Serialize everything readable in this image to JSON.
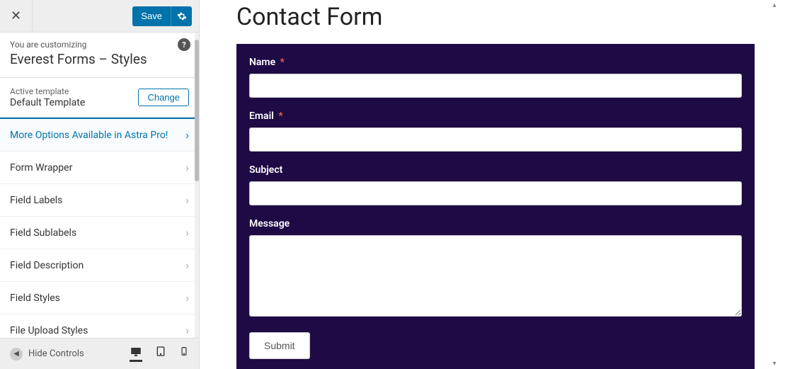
{
  "sidebar": {
    "save_label": "Save",
    "customizing_label": "You are customizing",
    "panel_title": "Everest Forms – Styles",
    "template_label": "Active template",
    "template_value": "Default Template",
    "change_label": "Change",
    "items": [
      {
        "label": "More Options Available in Astra Pro!",
        "promo": true
      },
      {
        "label": "Form Wrapper"
      },
      {
        "label": "Field Labels"
      },
      {
        "label": "Field Sublabels"
      },
      {
        "label": "Field Description"
      },
      {
        "label": "Field Styles"
      },
      {
        "label": "File Upload Styles"
      }
    ],
    "hide_controls_label": "Hide Controls"
  },
  "preview": {
    "title": "Contact Form",
    "fields": {
      "name": {
        "label": "Name",
        "required": true,
        "value": ""
      },
      "email": {
        "label": "Email",
        "required": true,
        "value": ""
      },
      "subject": {
        "label": "Subject",
        "required": false,
        "value": ""
      },
      "message": {
        "label": "Message",
        "required": false,
        "value": ""
      }
    },
    "submit_label": "Submit"
  },
  "colors": {
    "accent": "#0073aa",
    "form_bg": "#1e0a45",
    "required": "#e64"
  }
}
